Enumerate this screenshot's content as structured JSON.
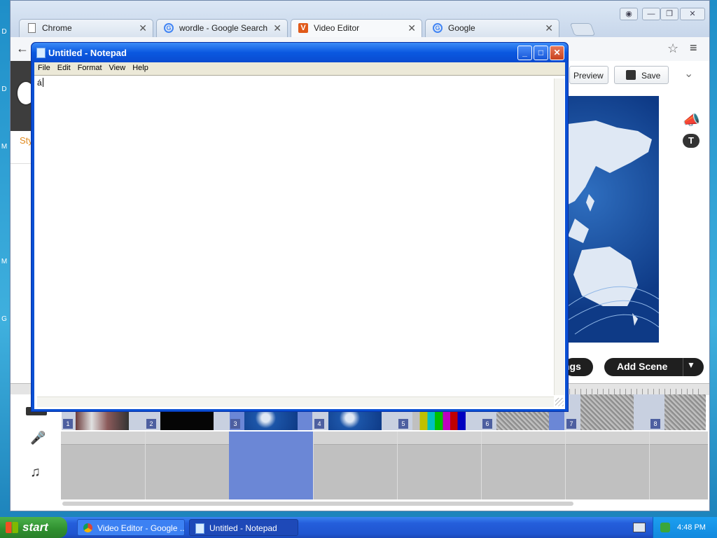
{
  "desktop": {
    "edge_letters": [
      "D",
      "M",
      "M",
      "G"
    ]
  },
  "chrome": {
    "tabs": [
      {
        "label": "Chrome",
        "icon": "page-icon"
      },
      {
        "label": "wordle - Google Search",
        "icon": "google-icon"
      },
      {
        "label": "Video Editor",
        "icon": "video-editor-icon",
        "active": true
      },
      {
        "label": "Google",
        "icon": "google-icon"
      }
    ],
    "editor": {
      "partial_sidebar_text": "Sty",
      "preview_label": "Preview",
      "save_label": "Save",
      "settings_partial_label": "ngs",
      "add_scene_label": "Add Scene",
      "scenes": [
        "1",
        "2",
        "3",
        "4",
        "5",
        "6",
        "7",
        "8"
      ]
    }
  },
  "notepad": {
    "title": "Untitled - Notepad",
    "menu": [
      "File",
      "Edit",
      "Format",
      "View",
      "Help"
    ],
    "text": "á"
  },
  "taskbar": {
    "start_label": "start",
    "tasks": [
      {
        "label": "Video Editor - Google ..."
      },
      {
        "label": "Untitled - Notepad",
        "active": true
      }
    ],
    "clock": "4:48 PM"
  },
  "colors": {
    "xp_blue": "#0a4fd4",
    "accent_blue": "#6b87d6"
  }
}
